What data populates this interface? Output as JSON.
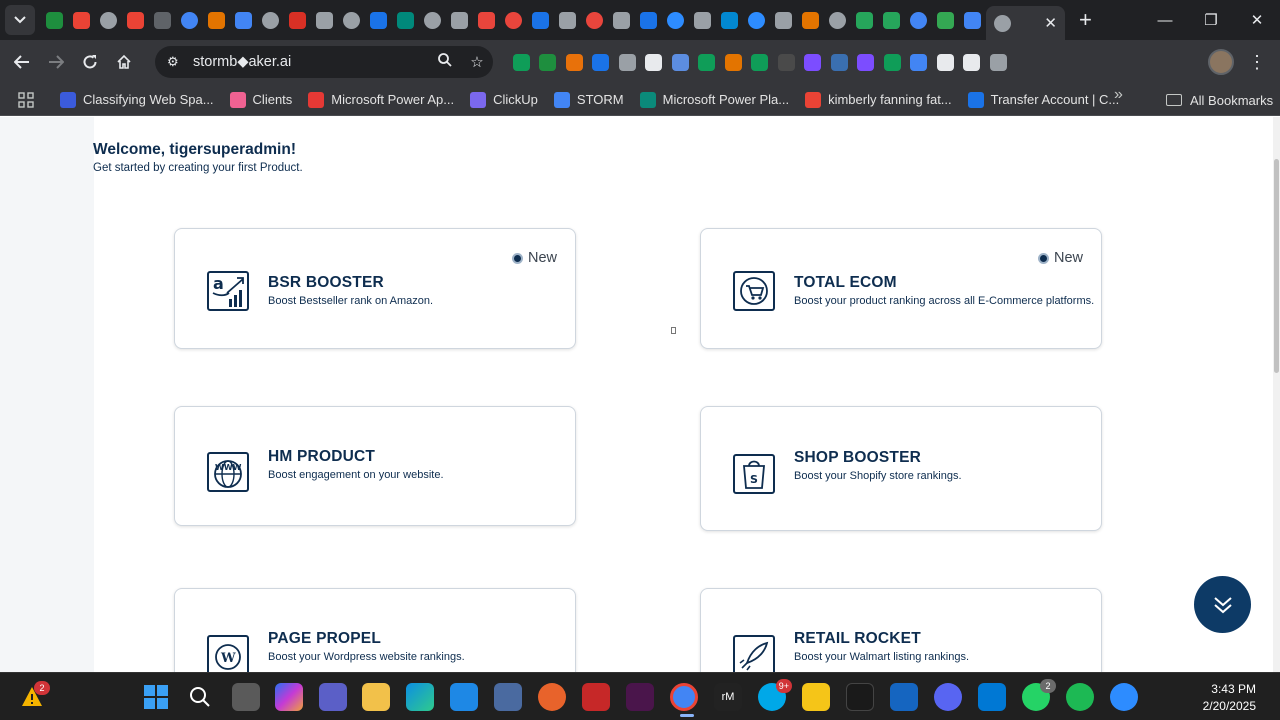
{
  "browser": {
    "tab_menu_icon": "chevron-down-icon",
    "new_tab": "+",
    "close_tab": "✕",
    "minimize": "—",
    "restore": "❐",
    "close_window": "✕",
    "tab_favicon_colors": [
      "#1e8e3e",
      "#ea4335",
      "#9aa0a6",
      "#ea4335",
      "#5f6368",
      "#4285f4",
      "#e37400",
      "#4285f4",
      "#9aa0a6",
      "#d93025",
      "#9aa0a6",
      "#9aa0a6",
      "#1a73e8",
      "#00897b",
      "#9aa0a6",
      "#9aa0a6",
      "#e8453c",
      "#e8453c",
      "#1a73e8",
      "#9aa0a6",
      "#e8453c",
      "#9aa0a6",
      "#1a73e8",
      "#2d8cff",
      "#9aa0a6",
      "#0288d1",
      "#2d8cff",
      "#9aa0a6",
      "#e37400",
      "#9aa0a6",
      "#26a65b",
      "#26a65b",
      "#4285f4",
      "#34a853",
      "#4285f4"
    ],
    "active_tab_favicon": "#9aa0a6",
    "url": "stormb◆aker.ai",
    "extension_colors": [
      "#0f9d58",
      "#1e8e3e",
      "#e8710a",
      "#1a73e8",
      "#9aa0a6",
      "#e8eaed",
      "#5c8de0",
      "#0f9d58",
      "#e37400",
      "#0f9d58",
      "#4a4a4a",
      "#7c4dff",
      "#3a6fb0",
      "#7c4dff",
      "#0f9d58",
      "#4285f4",
      "#e8eaed",
      "#e8eaed",
      "#9aa0a6"
    ]
  },
  "bookmarks": [
    {
      "label": "Classifying Web Spa...",
      "color": "#3b5bdb"
    },
    {
      "label": "Clients",
      "color": "#f06292"
    },
    {
      "label": "Microsoft Power Ap...",
      "color": "#e53935"
    },
    {
      "label": "ClickUp",
      "color": "#7b68ee"
    },
    {
      "label": "STORM",
      "color": "#4285f4"
    },
    {
      "label": "Microsoft Power Pla...",
      "color": "#0b8a7a"
    },
    {
      "label": "kimberly fanning fat...",
      "color": "#ea4335"
    },
    {
      "label": "Transfer Account | C...",
      "color": "#1a73e8"
    }
  ],
  "bookmarks_more": "»",
  "all_bookmarks": "All Bookmarks",
  "page": {
    "welcome": "Welcome, tigersuperadmin!",
    "subtitle": "Get started by creating your first Product.",
    "cards": [
      {
        "title": "BSR BOOSTER",
        "description": "Boost Bestseller rank on Amazon.",
        "badge": "New",
        "icon": "amazon-chart-icon"
      },
      {
        "title": "TOTAL ECOM",
        "description": "Boost your product ranking across all E-Commerce platforms.",
        "badge": "New",
        "icon": "cart-globe-icon"
      },
      {
        "title": "HM PRODUCT",
        "description": "Boost engagement on your website.",
        "badge": "",
        "icon": "www-globe-icon"
      },
      {
        "title": "SHOP BOOSTER",
        "description": "Boost your Shopify store rankings.",
        "badge": "",
        "icon": "shopify-bag-icon"
      },
      {
        "title": "PAGE PROPEL",
        "description": "Boost your Wordpress website rankings.",
        "badge": "",
        "icon": "wordpress-icon"
      },
      {
        "title": "RETAIL ROCKET",
        "description": "Boost your Walmart listing rankings.",
        "badge": "",
        "icon": "rocket-icon"
      }
    ],
    "scroll_button_icon": "double-chevron-down-icon"
  },
  "taskbar": {
    "weather_badge": "2",
    "skype_badge": "9+",
    "whatsapp_badge": "2",
    "time": "3:43 PM",
    "date": "2/20/2025",
    "colors": {
      "accent": "#0d3a66",
      "text": "#0e2d4f"
    }
  }
}
